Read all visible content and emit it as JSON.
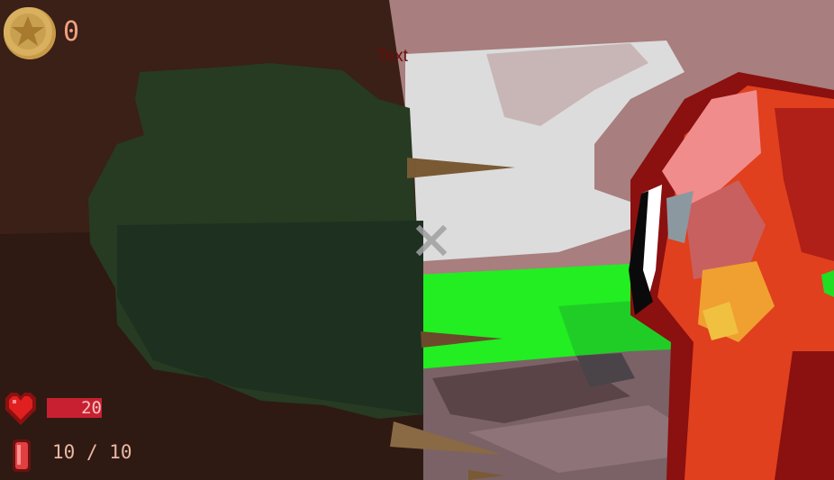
{
  "hud": {
    "coins": {
      "icon": "coin-star-icon",
      "count": "0"
    },
    "debug_label": "Text",
    "health": {
      "icon": "heart-icon",
      "value": "20"
    },
    "ammo": {
      "icon": "bullet-icon",
      "current": "10",
      "separator": "/",
      "max": "10"
    },
    "crosshair": {
      "icon": "crosshair-x-icon"
    }
  },
  "colors": {
    "sky": "#a87e7e",
    "cloud": "#dcdcdc",
    "grass": "#22ee22",
    "tree_trunk": "#3a2016",
    "foliage": "#263b22",
    "creature_red": "#e0401e",
    "creature_dark": "#8b1010",
    "health_red": "#c82030",
    "coin_gold": "#d8b060",
    "hud_text": "#e9b8a4"
  }
}
